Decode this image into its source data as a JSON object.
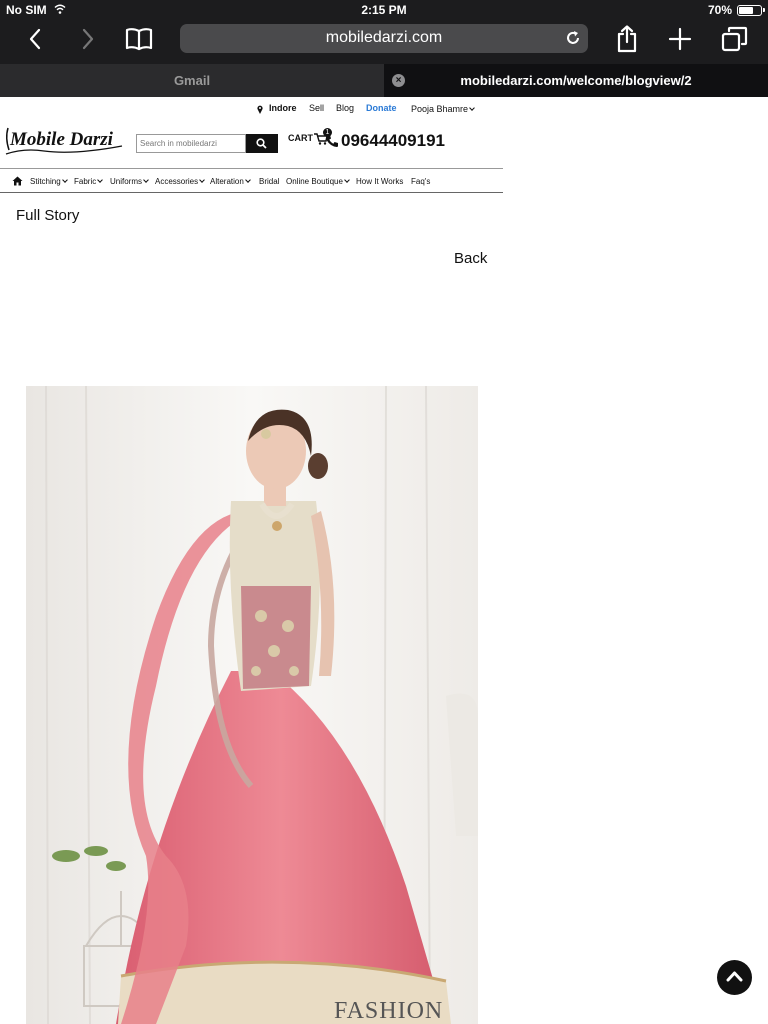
{
  "status": {
    "carrier": "No SIM",
    "time": "2:15 PM",
    "battery": "70%",
    "battery_level": 0.7
  },
  "browser": {
    "url": "mobiledarzi.com",
    "tabs": [
      {
        "label": "Gmail"
      },
      {
        "label": "mobiledarzi.com/welcome/blogview/2"
      }
    ]
  },
  "site": {
    "topbar": {
      "location": "Indore",
      "sell": "Sell",
      "blog": "Blog",
      "donate": "Donate",
      "user": "Pooja Bhamre"
    },
    "logo_text": "Mobile Darzi",
    "search_placeholder": "Search in mobiledarzi",
    "cart_label": "CART",
    "cart_count": "1",
    "phone": "09644409191",
    "menu": [
      "Stitching",
      "Fabric",
      "Uniforms",
      "Accessories",
      "Alteration",
      "Bridal",
      "Online Boutique",
      "How It Works",
      "Faq's"
    ]
  },
  "page": {
    "heading": "Full Story",
    "back_label": "Back",
    "image_watermark": "FASHION"
  },
  "colors": {
    "accent": "#2a7ad6",
    "chrome": "#1c1c1e",
    "dress_pink": "#e06a7a",
    "dupatta": "#e8808a"
  }
}
